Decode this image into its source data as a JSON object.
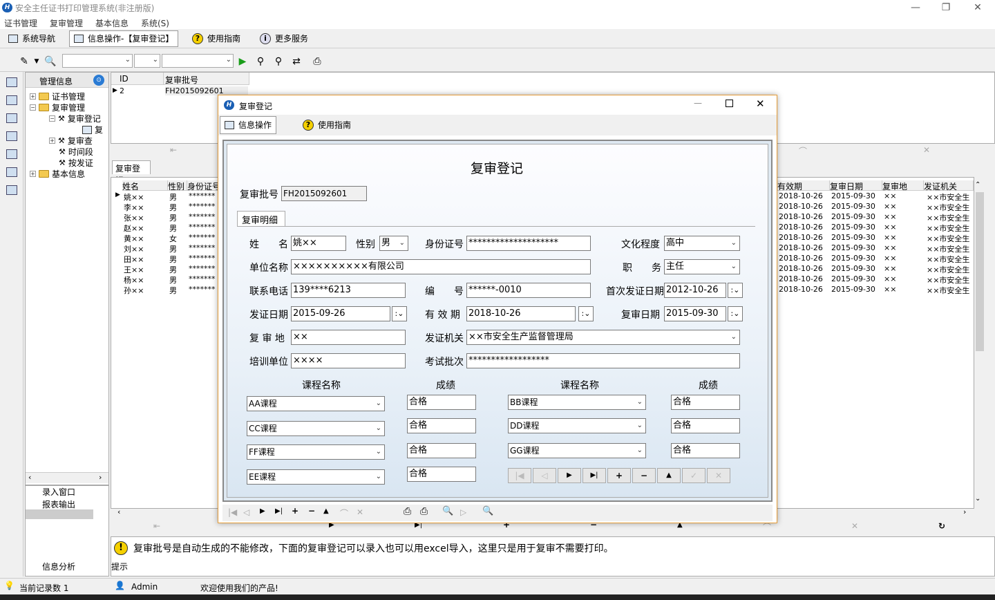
{
  "window": {
    "title": "安全主任证书打印管理系统(非注册版)",
    "logo": "logo-icon",
    "minimize": "—",
    "restore": "❐",
    "close": "✕"
  },
  "menu": [
    "证书管理",
    "复审管理",
    "基本信息",
    "系统(S)"
  ],
  "nav_tabs": [
    "系统导航",
    "信息操作-【复审登记】",
    "使用指南",
    "更多服务"
  ],
  "tree": {
    "header": "管理信息",
    "items": [
      "证书管理",
      "复审管理",
      "复审登记",
      "复",
      "复审查",
      "时间段",
      "按发证",
      "基本信息"
    ]
  },
  "left_bottom": [
    "录入窗口",
    "报表输出",
    "信息分析"
  ],
  "top_grid": {
    "columns": [
      "ID",
      "复审批号"
    ],
    "rows": [
      [
        "2",
        "FH2015092601"
      ]
    ]
  },
  "tab_label": "复审登记",
  "main_grid": {
    "left_columns": [
      "姓名",
      "性别",
      "身份证号"
    ],
    "right_columns": [
      "有效期",
      "复审日期",
      "复审地",
      "发证机关"
    ],
    "rows": [
      {
        "name": "姚××",
        "sex": "男",
        "id": "*******",
        "valid": "2018-10-26",
        "review": "2015-09-30",
        "place": "××",
        "org": "××市安全生"
      },
      {
        "name": "李××",
        "sex": "男",
        "id": "*******",
        "valid": "2018-10-26",
        "review": "2015-09-30",
        "place": "××",
        "org": "××市安全生"
      },
      {
        "name": "张××",
        "sex": "男",
        "id": "*******",
        "valid": "2018-10-26",
        "review": "2015-09-30",
        "place": "××",
        "org": "××市安全生"
      },
      {
        "name": "赵××",
        "sex": "男",
        "id": "*******",
        "valid": "2018-10-26",
        "review": "2015-09-30",
        "place": "××",
        "org": "××市安全生"
      },
      {
        "name": "黄××",
        "sex": "女",
        "id": "*******",
        "valid": "2018-10-26",
        "review": "2015-09-30",
        "place": "××",
        "org": "××市安全生"
      },
      {
        "name": "刘××",
        "sex": "男",
        "id": "*******",
        "valid": "2018-10-26",
        "review": "2015-09-30",
        "place": "××",
        "org": "××市安全生"
      },
      {
        "name": "田××",
        "sex": "男",
        "id": "*******",
        "valid": "2018-10-26",
        "review": "2015-09-30",
        "place": "××",
        "org": "××市安全生"
      },
      {
        "name": "王××",
        "sex": "男",
        "id": "*******",
        "valid": "2018-10-26",
        "review": "2015-09-30",
        "place": "××",
        "org": "××市安全生"
      },
      {
        "name": "杨××",
        "sex": "男",
        "id": "*******",
        "valid": "2018-10-26",
        "review": "2015-09-30",
        "place": "××",
        "org": "××市安全生"
      },
      {
        "name": "孙××",
        "sex": "男",
        "id": "*******",
        "valid": "2018-10-26",
        "review": "2015-09-30",
        "place": "××",
        "org": "××市安全生"
      }
    ]
  },
  "dialog": {
    "title": "复审登记",
    "tabs": [
      "信息操作",
      "使用指南"
    ],
    "heading": "复审登记",
    "batch_label": "复审批号",
    "batch_value": "FH2015092601",
    "detail_tab": "复审明细",
    "fields": {
      "name_label": "姓　　名",
      "name": "姚××",
      "sex_label": "性别",
      "sex": "男",
      "idno_label": "身份证号",
      "idno": "********************",
      "edu_label": "文化程度",
      "edu": "高中",
      "unit_label": "单位名称",
      "unit": "××××××××××有限公司",
      "job_label": "职　　务",
      "job": "主任",
      "phone_label": "联系电话",
      "phone": "139****6213",
      "no_label": "编　　号",
      "no": "******-0010",
      "first_date_label": "首次发证日期",
      "first_date": "2012-10-26",
      "issue_date_label": "发证日期",
      "issue_date": "2015-09-26",
      "valid_label": "有 效 期",
      "valid": "2018-10-26",
      "review_date_label": "复审日期",
      "review_date": "2015-09-30",
      "place_label": "复 审 地",
      "place": "××",
      "org_label": "发证机关",
      "org": "××市安全生产监督管理局",
      "train_label": "培训单位",
      "train": "××××",
      "exam_label": "考试批次",
      "exam": "******************"
    },
    "course_header": "课程名称",
    "score_header": "成绩",
    "courses_left": [
      {
        "name": "AA课程",
        "score": "合格"
      },
      {
        "name": "CC课程",
        "score": "合格"
      },
      {
        "name": "FF课程",
        "score": "合格"
      },
      {
        "name": "EE课程",
        "score": "合格"
      }
    ],
    "courses_right": [
      {
        "name": "BB课程",
        "score": "合格"
      },
      {
        "name": "DD课程",
        "score": "合格"
      },
      {
        "name": "GG课程",
        "score": "合格"
      }
    ]
  },
  "message": "复审批号是自动生成的不能修改，下面的复审登记可以录入也可以用excel导入，这里只是用于复审不需要打印。",
  "hint_label": "提示",
  "status": {
    "record_count": "当前记录数 1",
    "user": "Admin",
    "welcome": "欢迎使用我们的产品!"
  }
}
